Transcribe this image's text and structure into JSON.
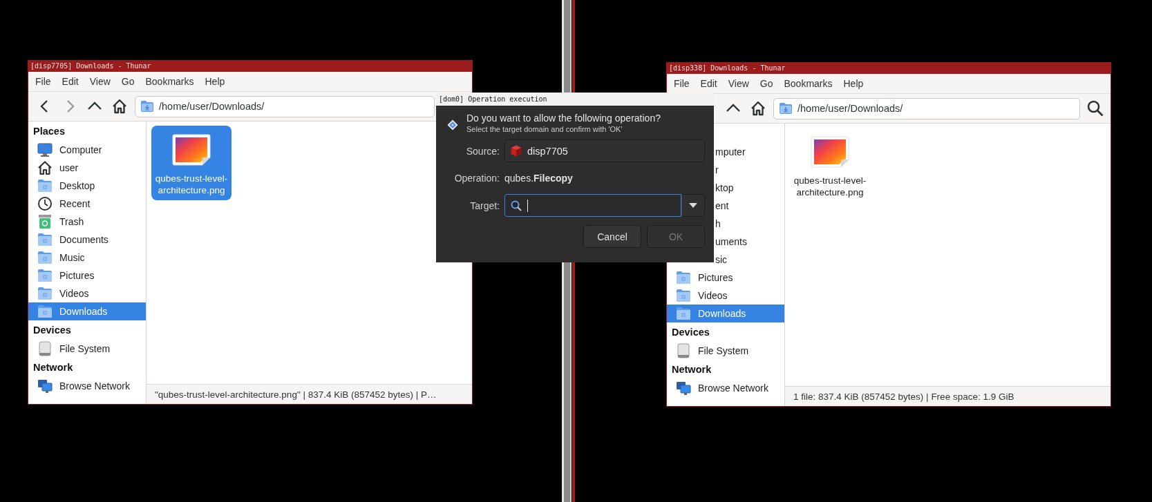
{
  "windows": [
    {
      "title": "[disp7705] Downloads - Thunar",
      "menu": [
        "File",
        "Edit",
        "View",
        "Go",
        "Bookmarks",
        "Help"
      ],
      "nav_buttons": [
        {
          "kind": "back",
          "disabled": false
        },
        {
          "kind": "forward",
          "disabled": true
        },
        {
          "kind": "up",
          "disabled": false
        },
        {
          "kind": "home",
          "disabled": false
        }
      ],
      "path": "/home/user/Downloads/",
      "sidebar": [
        {
          "heading": "Places",
          "items": [
            {
              "label": "Computer",
              "kind": "computer",
              "selected": false
            },
            {
              "label": "user",
              "kind": "home",
              "selected": false
            },
            {
              "label": "Desktop",
              "kind": "folder",
              "selected": false
            },
            {
              "label": "Recent",
              "kind": "recent",
              "selected": false
            },
            {
              "label": "Trash",
              "kind": "trash",
              "selected": false
            },
            {
              "label": "Documents",
              "kind": "folder",
              "selected": false
            },
            {
              "label": "Music",
              "kind": "folder",
              "selected": false
            },
            {
              "label": "Pictures",
              "kind": "folder",
              "selected": false
            },
            {
              "label": "Videos",
              "kind": "folder",
              "selected": false
            },
            {
              "label": "Downloads",
              "kind": "folder",
              "selected": true
            }
          ]
        },
        {
          "heading": "Devices",
          "items": [
            {
              "label": "File System",
              "kind": "drive",
              "selected": false
            }
          ]
        },
        {
          "heading": "Network",
          "items": [
            {
              "label": "Browse Network",
              "kind": "network",
              "selected": false
            }
          ]
        }
      ],
      "files": [
        {
          "name": "qubes-trust-level-architecture.png",
          "selected": true
        }
      ],
      "status": "\"qubes-trust-level-architecture.png\"  |  837.4 KiB (857452 bytes)  |  P…"
    },
    {
      "title": "[disp338] Downloads - Thunar",
      "menu": [
        "File",
        "Edit",
        "View",
        "Go",
        "Bookmarks",
        "Help"
      ],
      "nav_buttons": [
        {
          "kind": "up",
          "disabled": false
        },
        {
          "kind": "home",
          "disabled": false
        }
      ],
      "path": "/home/user/Downloads/",
      "end_buttons": [
        {
          "kind": "search"
        }
      ],
      "sidebar": [
        {
          "items": [
            {
              "label": "mputer",
              "selected": false
            },
            {
              "label": "r",
              "selected": false
            },
            {
              "label": "ktop",
              "selected": false
            },
            {
              "label": "ent",
              "selected": false
            },
            {
              "label": "h",
              "selected": false
            },
            {
              "label": "uments",
              "selected": false
            },
            {
              "label": "sic",
              "selected": false
            },
            {
              "label": "Pictures",
              "kind": "folder",
              "selected": false
            },
            {
              "label": "Videos",
              "kind": "folder",
              "selected": false
            },
            {
              "label": "Downloads",
              "kind": "folder",
              "selected": true
            }
          ]
        },
        {
          "heading": "Devices",
          "items": [
            {
              "label": "File System",
              "kind": "drive",
              "selected": false
            }
          ]
        },
        {
          "heading": "Network",
          "items": [
            {
              "label": "Browse Network",
              "kind": "network",
              "selected": false
            }
          ]
        }
      ],
      "files": [
        {
          "name": "qubes-trust-level-architecture.png",
          "selected": false
        }
      ],
      "status": "1 file: 837.4 KiB (857452 bytes)  |  Free space: 1.9 GiB"
    }
  ],
  "dialog": {
    "title": "[dom0] Operation execution",
    "question": "Do you want to allow the following operation?",
    "hint": "Select the target domain and confirm with 'OK'",
    "source_label": "Source:",
    "source": "disp7705",
    "operation_label": "Operation:",
    "operation": "qubes.**Filecopy**",
    "target_label": "Target:",
    "target": {
      "focused": true
    },
    "buttons": [
      {
        "label": "Cancel",
        "disabled": false
      },
      {
        "label": "OK",
        "disabled": true
      }
    ]
  }
}
